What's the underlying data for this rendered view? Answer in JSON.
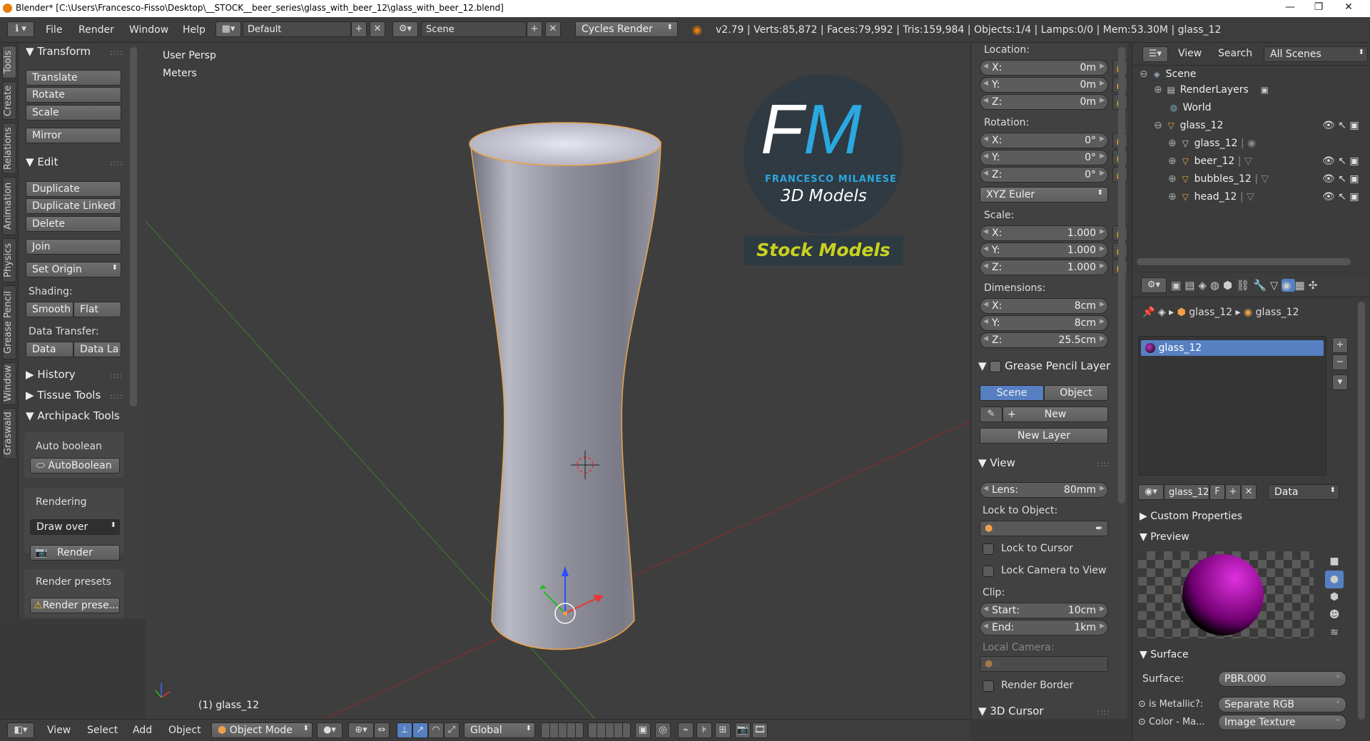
{
  "titlebar": {
    "title": "Blender* [C:\\Users\\Francesco-Fisso\\Desktop\\__STOCK__beer_series\\glass_with_beer_12\\glass_with_beer_12.blend]",
    "minimize": "—",
    "maximize": "❐",
    "close": "✕"
  },
  "infobar": {
    "menus": [
      "File",
      "Render",
      "Window",
      "Help"
    ],
    "layout": "Default",
    "scene": "Scene",
    "engine": "Cycles Render",
    "stats": "v2.79 | Verts:85,872 | Faces:79,992 | Tris:159,984 | Objects:1/4 | Lamps:0/0 | Mem:53.30M | glass_12"
  },
  "vtabs": [
    "Tools",
    "Create",
    "Relations",
    "Animation",
    "Physics",
    "Grease Pencil",
    "Window",
    "Graswald"
  ],
  "toolshelf": {
    "transform": {
      "title": "Transform",
      "buttons": [
        "Translate",
        "Rotate",
        "Scale",
        "Mirror"
      ]
    },
    "edit": {
      "title": "Edit",
      "buttons": [
        "Duplicate",
        "Duplicate Linked",
        "Delete",
        "Join",
        "Set Origin"
      ]
    },
    "shading": {
      "label": "Shading:",
      "smooth": "Smooth",
      "flat": "Flat"
    },
    "data_transfer": {
      "label": "Data Transfer:",
      "data": "Data",
      "data_la": "Data La"
    },
    "history": "History",
    "tissue": "Tissue Tools",
    "archipack": {
      "title": "Archipack Tools",
      "auto_boolean_label": "Auto boolean",
      "auto_boolean_btn": "AutoBoolean",
      "rendering_label": "Rendering",
      "draw_over": "Draw over",
      "render_btn": "Render",
      "presets_label": "Render presets",
      "presets_btn": "Render prese..."
    }
  },
  "viewport": {
    "view_name": "User Persp",
    "units": "Meters",
    "object_label": "(1) glass_12",
    "watermark": {
      "initials": "FM",
      "name": "FRANCESCO MILANESE",
      "sub": "3D Models",
      "banner": "Stock Models"
    }
  },
  "npanel": {
    "location_label": "Location:",
    "location": [
      {
        "k": "X:",
        "v": "0m"
      },
      {
        "k": "Y:",
        "v": "0m"
      },
      {
        "k": "Z:",
        "v": "0m"
      }
    ],
    "rotation_label": "Rotation:",
    "rotation": [
      {
        "k": "X:",
        "v": "0°"
      },
      {
        "k": "Y:",
        "v": "0°"
      },
      {
        "k": "Z:",
        "v": "0°"
      }
    ],
    "rotation_mode": "XYZ Euler",
    "scale_label": "Scale:",
    "scale": [
      {
        "k": "X:",
        "v": "1.000"
      },
      {
        "k": "Y:",
        "v": "1.000"
      },
      {
        "k": "Z:",
        "v": "1.000"
      }
    ],
    "dimensions_label": "Dimensions:",
    "dimensions": [
      {
        "k": "X:",
        "v": "8cm"
      },
      {
        "k": "Y:",
        "v": "8cm"
      },
      {
        "k": "Z:",
        "v": "25.5cm"
      }
    ],
    "grease_pencil": {
      "title": "Grease Pencil Layer",
      "scene": "Scene",
      "object": "Object",
      "new": "New",
      "new_layer": "New Layer"
    },
    "view": {
      "title": "View",
      "lens_k": "Lens:",
      "lens_v": "80mm",
      "lock_obj": "Lock to Object:",
      "lock_cursor": "Lock to Cursor",
      "lock_camera": "Lock Camera to View",
      "clip": "Clip:",
      "start_k": "Start:",
      "start_v": "10cm",
      "end_k": "End:",
      "end_v": "1km",
      "local_camera": "Local Camera:",
      "render_border": "Render Border"
    },
    "cursor": "3D Cursor"
  },
  "outliner": {
    "menus": [
      "View",
      "Search"
    ],
    "filter": "All Scenes",
    "items": [
      "Scene",
      "RenderLayers",
      "World",
      "glass_12",
      "glass_12",
      "beer_12",
      "bubbles_12",
      "head_12"
    ]
  },
  "props": {
    "crumb_obj": "glass_12",
    "crumb_mat": "glass_12",
    "slot": "glass_12",
    "mat_name": "glass_12",
    "mat_f": "F",
    "link": "Data",
    "custom_props": "Custom Properties",
    "preview": "Preview",
    "surface_title": "Surface",
    "surface_k": "Surface:",
    "surface_v": "PBR.000",
    "metallic_k": "is Metallic?:",
    "metallic_v": "Separate RGB",
    "color_k": "Color - Ma...",
    "color_v": "Image Texture"
  },
  "bottombar": {
    "menus": [
      "View",
      "Select",
      "Add",
      "Object"
    ],
    "mode": "Object Mode",
    "orientation": "Global"
  },
  "colors": {
    "accent": "#5680c2",
    "selected": "#f5a23b",
    "background": "#393939"
  }
}
